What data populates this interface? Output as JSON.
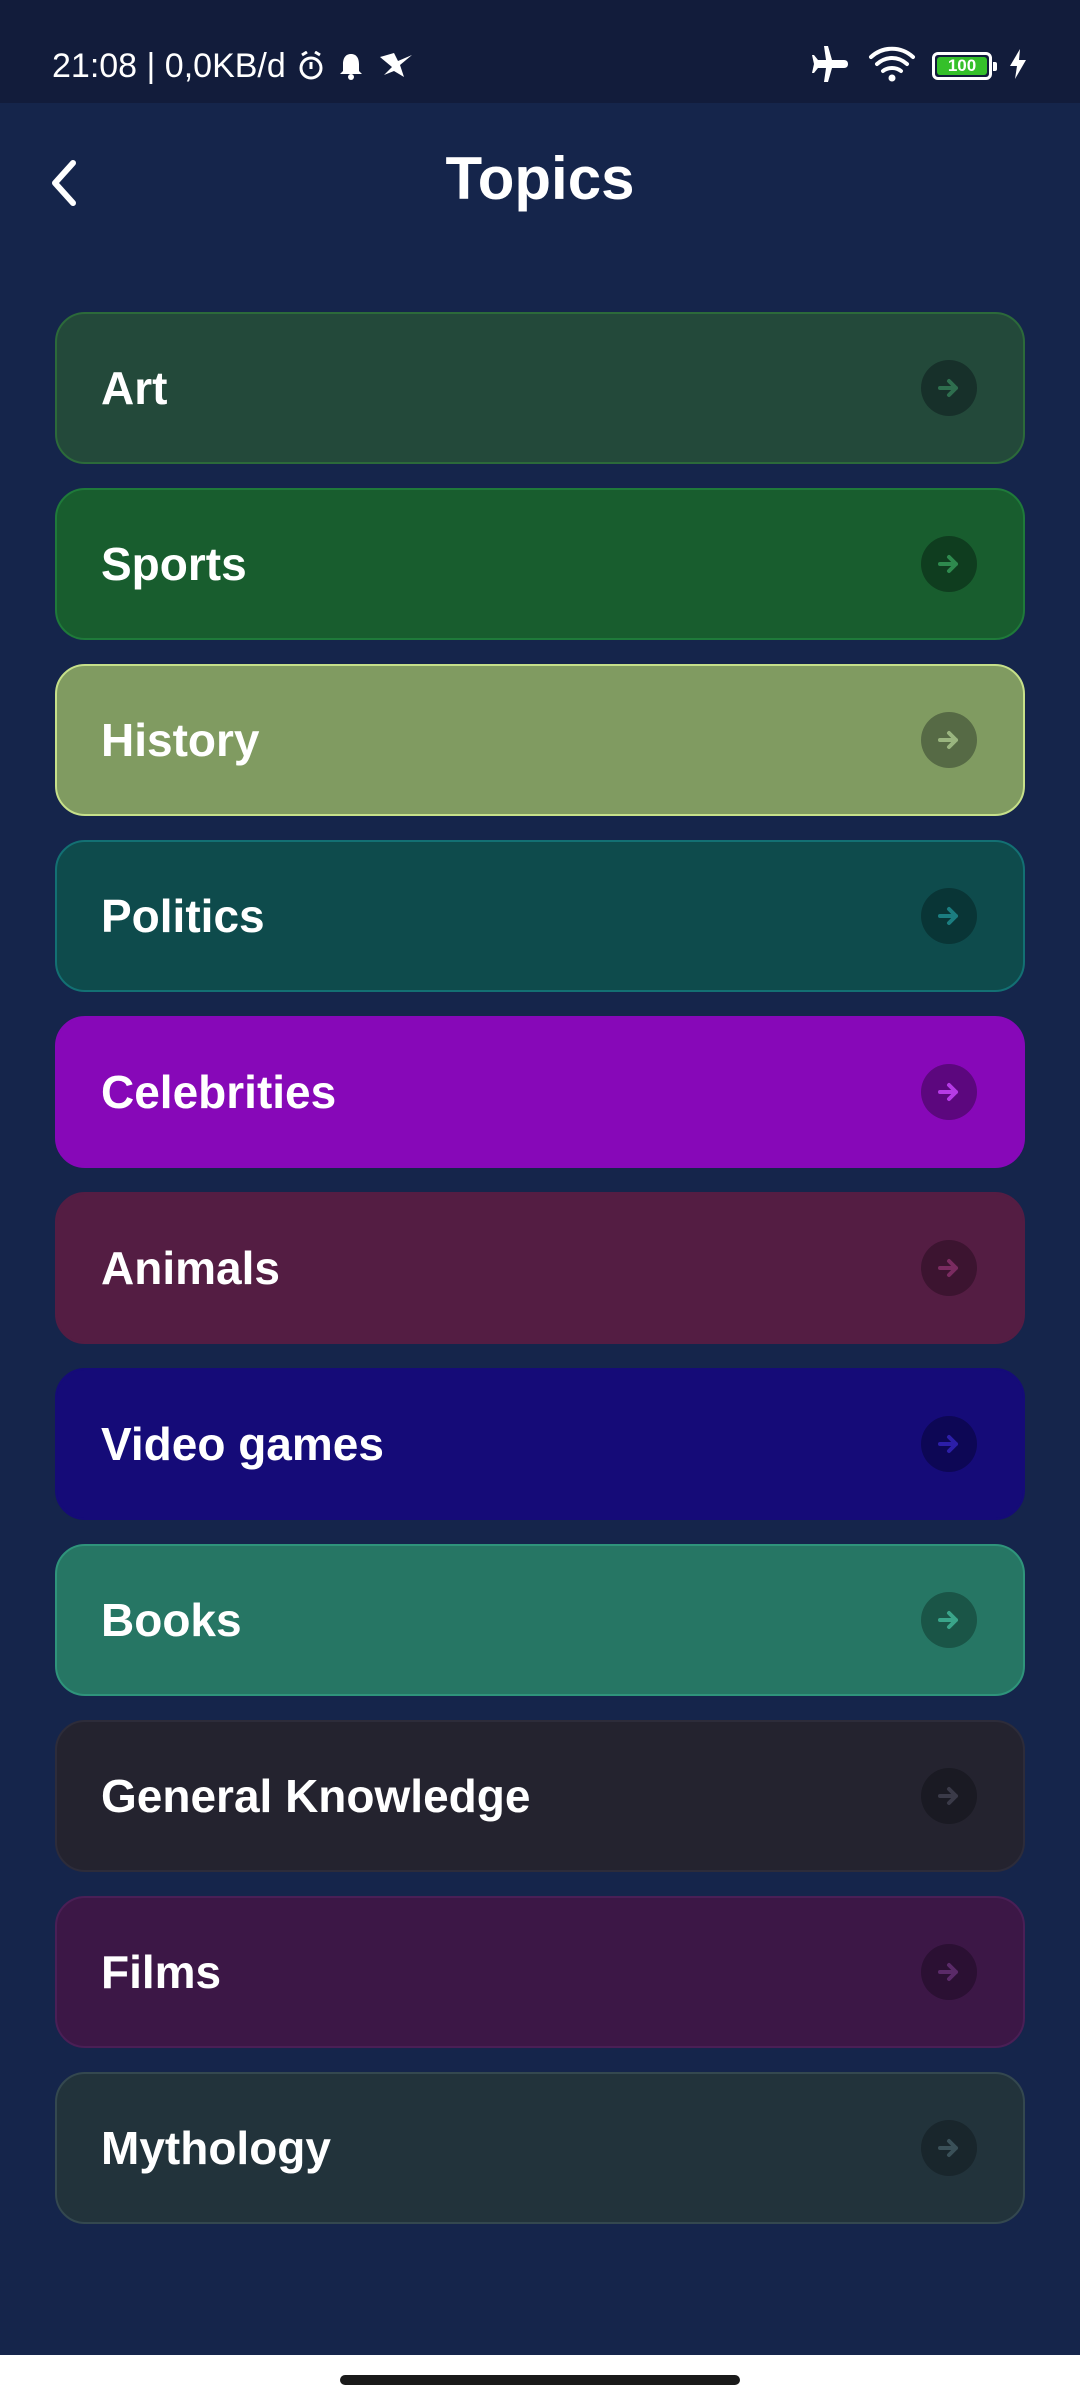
{
  "status_bar": {
    "time_info": "21:08 | 0,0KB/d",
    "battery_level": "100",
    "battery_percent": 100,
    "icons": [
      "alarm-icon",
      "bell-icon",
      "bird-icon",
      "airplane-mode-icon",
      "wifi-icon",
      "battery-icon",
      "charging-icon"
    ]
  },
  "header": {
    "title": "Topics",
    "back_icon": "chevron-left-icon"
  },
  "topics": [
    {
      "label": "Art",
      "bg": "#23493a",
      "border": "#2c6a3a",
      "arrow_bg": "#17302a",
      "arrow_color": "#2e6e4e"
    },
    {
      "label": "Sports",
      "bg": "#185d2e",
      "border": "#1f7a3a",
      "arrow_bg": "#0f3d1f",
      "arrow_color": "#2e8a4e"
    },
    {
      "label": "History",
      "bg": "#809b61",
      "border": "#c6e08a",
      "arrow_bg": "#566a45",
      "arrow_color": "#9ab57f"
    },
    {
      "label": "Politics",
      "bg": "#0e4b4c",
      "border": "#137073",
      "arrow_bg": "#093536",
      "arrow_color": "#1b7d80"
    },
    {
      "label": "Celebrities",
      "bg": "#8708b8",
      "border": "#8708b8",
      "arrow_bg": "#5c077e",
      "arrow_color": "#b63ae6"
    },
    {
      "label": "Animals",
      "bg": "#541d43",
      "border": "#541d43",
      "arrow_bg": "#3c1430",
      "arrow_color": "#7a2b60"
    },
    {
      "label": "Video games",
      "bg": "#150b78",
      "border": "#150b78",
      "arrow_bg": "#0d0755",
      "arrow_color": "#2c1ea8"
    },
    {
      "label": "Books",
      "bg": "#267664",
      "border": "#2f947b",
      "arrow_bg": "#1a5547",
      "arrow_color": "#3aa58a"
    },
    {
      "label": "General Knowledge",
      "bg": "#24232f",
      "border": "#2d2c3a",
      "arrow_bg": "#1a1a23",
      "arrow_color": "#3a3a48"
    },
    {
      "label": "Films",
      "bg": "#3c1746",
      "border": "#4a1f56",
      "arrow_bg": "#2b1033",
      "arrow_color": "#5a2a68"
    },
    {
      "label": "Mythology",
      "bg": "#22333b",
      "border": "#34484f",
      "arrow_bg": "#19262c",
      "arrow_color": "#3a5058"
    }
  ],
  "arrow_icon": "arrow-right-icon"
}
